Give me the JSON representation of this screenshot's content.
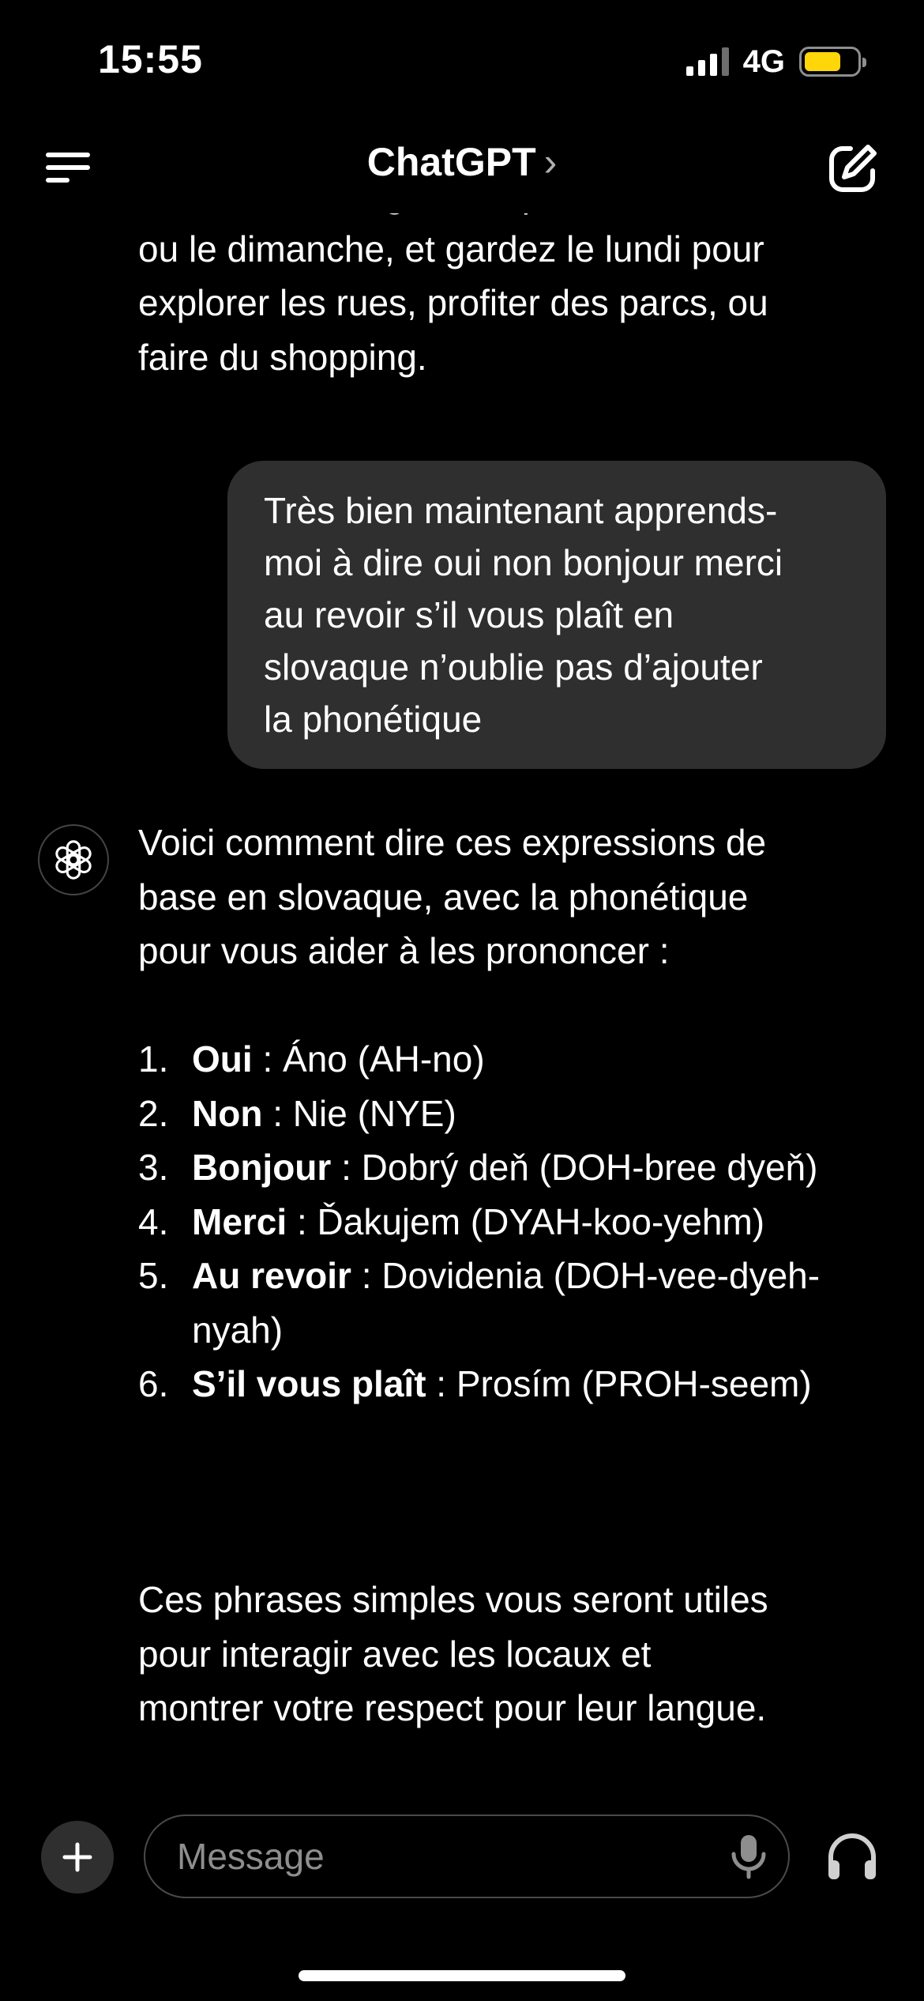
{
  "status_bar": {
    "time": "15:55",
    "network": "4G",
    "battery_color": "#ffd60a"
  },
  "nav": {
    "title": "ChatGPT",
    "chevron": "›"
  },
  "messages": {
    "assistant_prev": {
      "lines": [
        "musées et aux galeries pour le samedi",
        "ou le dimanche, et gardez le lundi pour",
        "explorer les rues, profiter des parcs, ou",
        "faire du shopping."
      ]
    },
    "user": {
      "lines": [
        "Très bien maintenant apprends-",
        "moi à dire oui non bonjour merci",
        "au revoir s’il vous plaît en",
        "slovaque n’oublie pas d’ajouter",
        "la phonétique"
      ]
    },
    "assistant": {
      "intro_lines": [
        "Voici comment dire ces expressions de",
        "base en slovaque, avec la phonétique",
        "pour vous aider à les prononcer :"
      ],
      "items": [
        {
          "num": "1.",
          "word": "Oui",
          "translation": " : Áno (AH-no)"
        },
        {
          "num": "2.",
          "word": "Non",
          "translation": " : Nie (NYE)"
        },
        {
          "num": "3.",
          "word": "Bonjour",
          "translation": " : Dobrý deň (DOH-bree dyeň)"
        },
        {
          "num": "4.",
          "word": "Merci",
          "translation": " : Ďakujem (DYAH-koo-yehm)"
        },
        {
          "num": "5.",
          "word": "Au revoir",
          "translation": " : Dovidenia (DOH-vee-dyeh-nyah)"
        },
        {
          "num": "6.",
          "word": "S’il vous plaît",
          "translation": " : Prosím (PROH-seem)"
        }
      ],
      "outro_lines": [
        "Ces phrases simples vous seront utiles",
        "pour interagir avec les locaux et",
        "montrer votre respect pour leur langue."
      ]
    }
  },
  "composer": {
    "placeholder": "Message"
  }
}
